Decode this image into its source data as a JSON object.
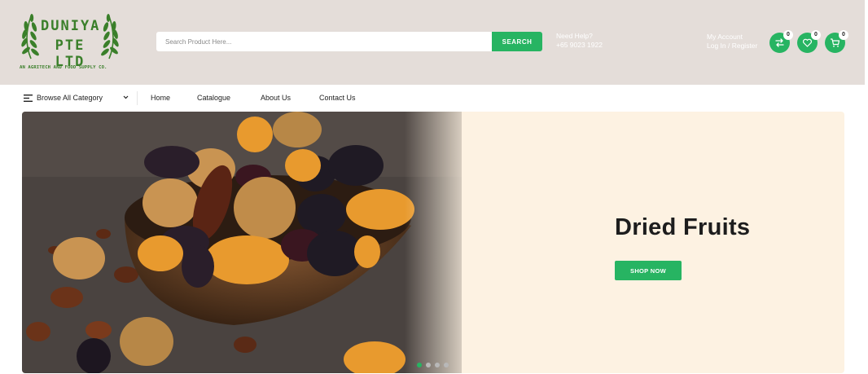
{
  "header": {
    "logo": {
      "line1": "DUNIYA",
      "line2": "PTE LTD",
      "tagline": "AN AGRITECH AND FOOD SUPPLY CO."
    },
    "search": {
      "placeholder": "Search Product Here...",
      "button_label": "SEARCH"
    },
    "help": {
      "label": "Need Help?",
      "phone": "+65 9023 1922"
    },
    "account": {
      "label": "My Account",
      "links": "Log In / Register"
    },
    "icons": [
      {
        "icon": "compare-icon",
        "count": "0"
      },
      {
        "icon": "heart-icon",
        "count": "0"
      },
      {
        "icon": "cart-icon",
        "count": "0"
      }
    ]
  },
  "nav": {
    "browse_label": "Browse All Category",
    "links": [
      "Home",
      "Catalogue",
      "About Us",
      "Contact Us"
    ]
  },
  "hero": {
    "title": "Dried Fruits",
    "button_label": "SHOP NOW",
    "slide_count": 4,
    "active_slide": 1
  },
  "colors": {
    "accent": "#27b462",
    "header_bg": "#e4ddd9",
    "hero_bg": "#fdf2e2",
    "logo_green": "#3a7f2a"
  }
}
